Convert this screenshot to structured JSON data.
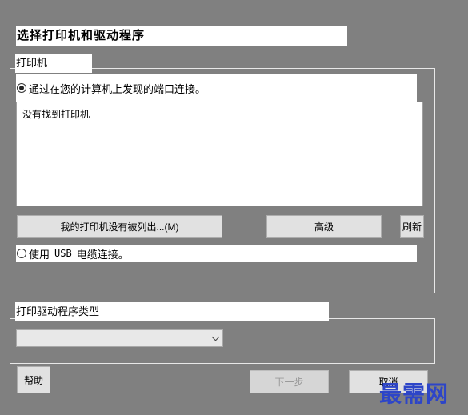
{
  "dialog": {
    "title": "选择打印机和驱动程序"
  },
  "printer_group": {
    "label": "打印机",
    "radio_port": {
      "label": "通过在您的计算机上发现的端口连接。",
      "checked": true
    },
    "list": {
      "empty_text": "没有找到打印机"
    },
    "not_listed_button": "我的打印机没有被列出...(M)",
    "advanced_button": "高级",
    "refresh_button": "刷新",
    "radio_usb": {
      "prefix": "使用",
      "usb": "USB",
      "suffix": "电缆连接。",
      "checked": false
    }
  },
  "driver_group": {
    "label": "打印驱动程序类型",
    "select_value": ""
  },
  "footer": {
    "help_button": "帮助",
    "next_button": "下一步",
    "cancel_button": "取消"
  },
  "watermark": {
    "text": "最需网"
  },
  "colors": {
    "background": "#808080",
    "panel": "#ffffff",
    "button": "#e1e1e1",
    "watermark": "#2d45c8"
  }
}
